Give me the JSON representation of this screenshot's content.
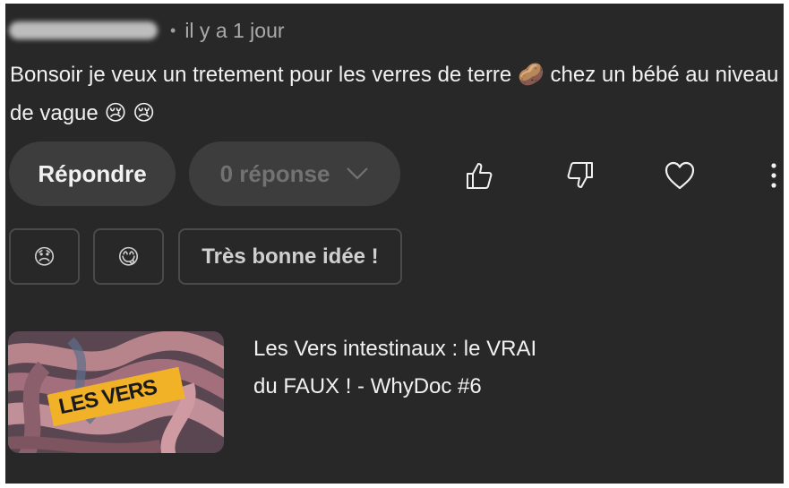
{
  "comment": {
    "timestamp": "il y a 1 jour",
    "separator": "•",
    "text": "Bonsoir je veux un tretement pour les verres de terre",
    "text_mid": "chez un bébé au niveau de vague",
    "emoji_potato": "🥔",
    "emoji_cry1": "😢",
    "emoji_cry2": "😢"
  },
  "actions": {
    "reply_label": "Répondre",
    "replies_label": "0 réponse",
    "icons": [
      "thumbs-up-icon",
      "thumbs-down-icon",
      "heart-icon",
      "more-vert-icon"
    ]
  },
  "suggestions": [
    {
      "label": "😞"
    },
    {
      "label": "😋"
    },
    {
      "label": "Très bonne idée !"
    }
  ],
  "video": {
    "title_line1": "Les Vers intestinaux : le VRAI",
    "title_line2": "du FAUX ! - WhyDoc #6",
    "thumbnail_label": "LES VERS"
  },
  "colors": {
    "background": "#282828",
    "text": "#f1f1f1",
    "muted": "#aaaaaa",
    "pill": "#3d3d3d"
  }
}
